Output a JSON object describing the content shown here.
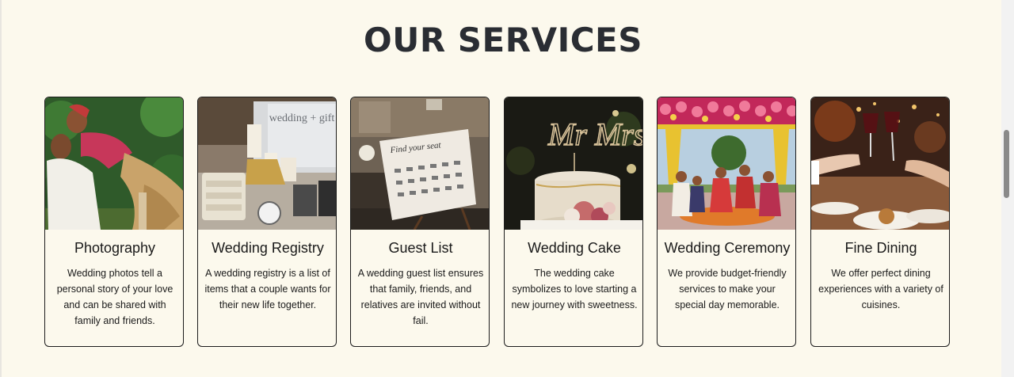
{
  "section": {
    "title": "OUR SERVICES"
  },
  "services": [
    {
      "title": "Photography",
      "description": "Wedding photos tell a personal story of your love and can be shared with family and friends.",
      "image_icon": "couple-photo"
    },
    {
      "title": "Wedding Registry",
      "description": "A wedding registry is a list of items that a couple wants for their new life together.",
      "image_icon": "registry-gifts-photo",
      "image_text": "wedding + gift"
    },
    {
      "title": "Guest List",
      "description": "A wedding guest list ensures that family, friends, and relatives are invited without fail.",
      "image_icon": "seating-chart-photo",
      "image_text": "Find your seat"
    },
    {
      "title": "Wedding Cake",
      "description": "The wedding cake symbolizes to love starting a new journey with sweetness.",
      "image_icon": "cake-photo",
      "image_text": "Mr Mrs"
    },
    {
      "title": "Wedding Ceremony",
      "description": "We provide budget-friendly services to make your special day memorable.",
      "image_icon": "ceremony-photo"
    },
    {
      "title": "Fine Dining",
      "description": "We offer perfect dining experiences with a variety of cuisines.",
      "image_icon": "dining-toast-photo"
    }
  ],
  "colors": {
    "background": "#fcf9ed",
    "title": "#2a2d33",
    "card_border": "#1c1c1c"
  }
}
